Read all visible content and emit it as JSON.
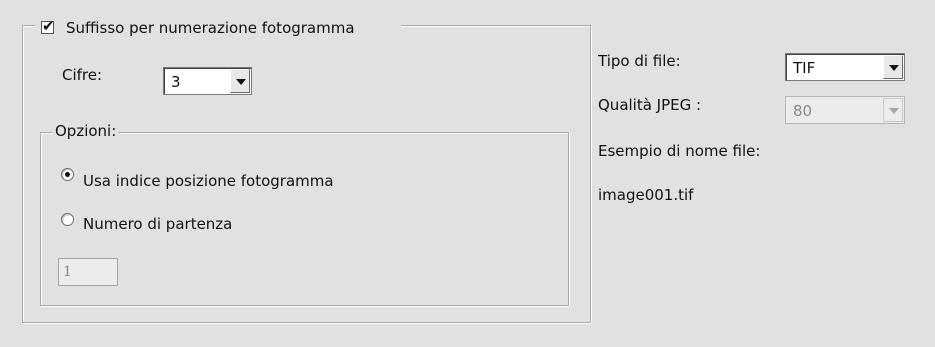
{
  "frame_suffix": {
    "checkbox_label": "Suffisso per numerazione fotogramma",
    "checked": true,
    "digits_label": "Cifre:",
    "digits_value": "3",
    "options": {
      "legend": "Opzioni:",
      "radio_use_index_label": "Usa indice posizione fotogramma",
      "radio_start_number_label": "Numero di partenza",
      "start_number_value": "1"
    }
  },
  "file": {
    "type_label": "Tipo di file:",
    "type_value": "TIF",
    "jpeg_quality_label": "Qualità JPEG :",
    "jpeg_quality_value": "80",
    "example_label": "Esempio di nome file:",
    "example_value": "image001.tif"
  },
  "icons": {
    "check": "✔",
    "dropdown": "chevron-down-icon"
  }
}
